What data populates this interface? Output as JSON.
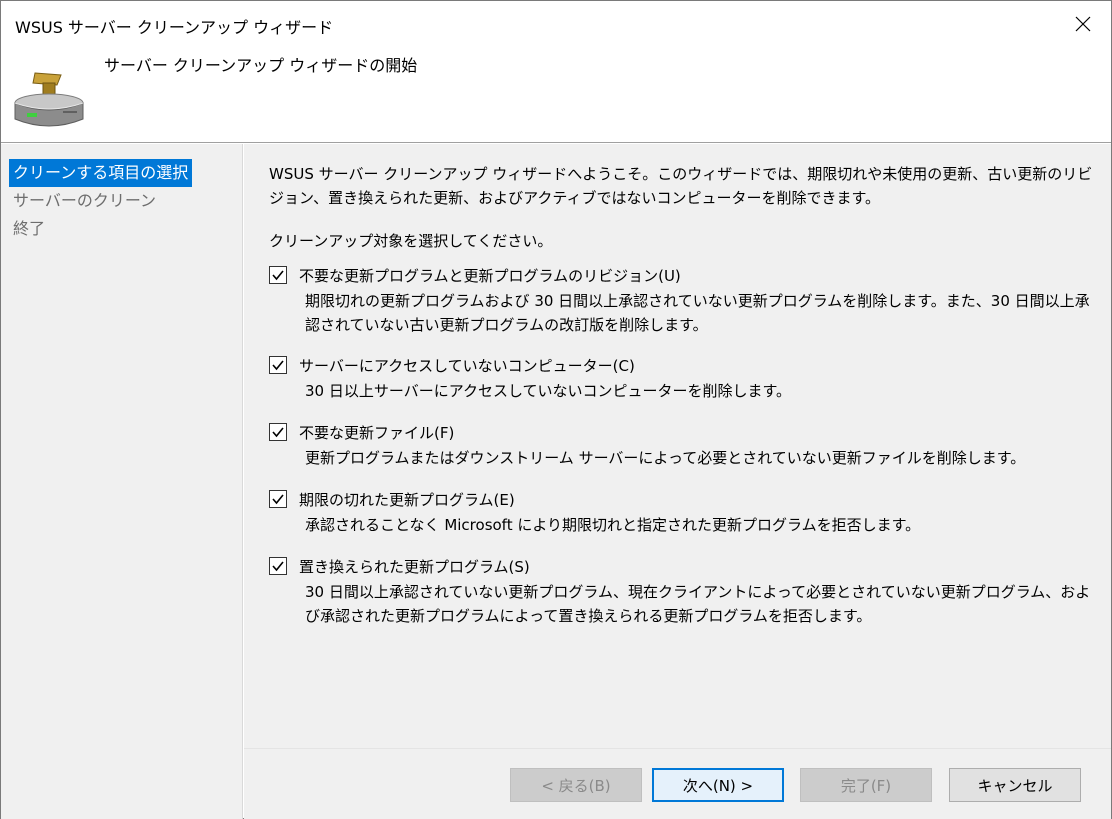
{
  "window": {
    "title": "WSUS サーバー クリーンアップ ウィザード"
  },
  "header": {
    "title": "サーバー クリーンアップ ウィザードの開始",
    "icon": "cleanup-brush-drive-icon"
  },
  "sidebar": {
    "steps": [
      {
        "label": "クリーンする項目の選択",
        "active": true
      },
      {
        "label": "サーバーのクリーン",
        "active": false
      },
      {
        "label": "終了",
        "active": false
      }
    ]
  },
  "main": {
    "intro": "WSUS サーバー クリーンアップ ウィザードへようこそ。このウィザードでは、期限切れや未使用の更新、古い更新のリビジョン、置き換えられた更新、およびアクティブではないコンピューターを削除できます。",
    "prompt": "クリーンアップ対象を選択してください。",
    "options": [
      {
        "label": "不要な更新プログラムと更新プログラムのリビジョン(U)",
        "checked": true,
        "description": "期限切れの更新プログラムおよび 30 日間以上承認されていない更新プログラムを削除します。また、30 日間以上承認されていない古い更新プログラムの改訂版を削除します。"
      },
      {
        "label": "サーバーにアクセスしていないコンピューター(C)",
        "checked": true,
        "description": "30 日以上サーバーにアクセスしていないコンピューターを削除します。"
      },
      {
        "label": "不要な更新ファイル(F)",
        "checked": true,
        "description": "更新プログラムまたはダウンストリーム サーバーによって必要とされていない更新ファイルを削除します。"
      },
      {
        "label": "期限の切れた更新プログラム(E)",
        "checked": true,
        "description": "承認されることなく Microsoft により期限切れと指定された更新プログラムを拒否します。"
      },
      {
        "label": "置き換えられた更新プログラム(S)",
        "checked": true,
        "description": "30 日間以上承認されていない更新プログラム、現在クライアントによって必要とされていない更新プログラム、および承認された更新プログラムによって置き換えられる更新プログラムを拒否します。"
      }
    ]
  },
  "footer": {
    "back": "< 戻る(B)",
    "next": "次へ(N) >",
    "finish": "完了(F)",
    "cancel": "キャンセル"
  }
}
